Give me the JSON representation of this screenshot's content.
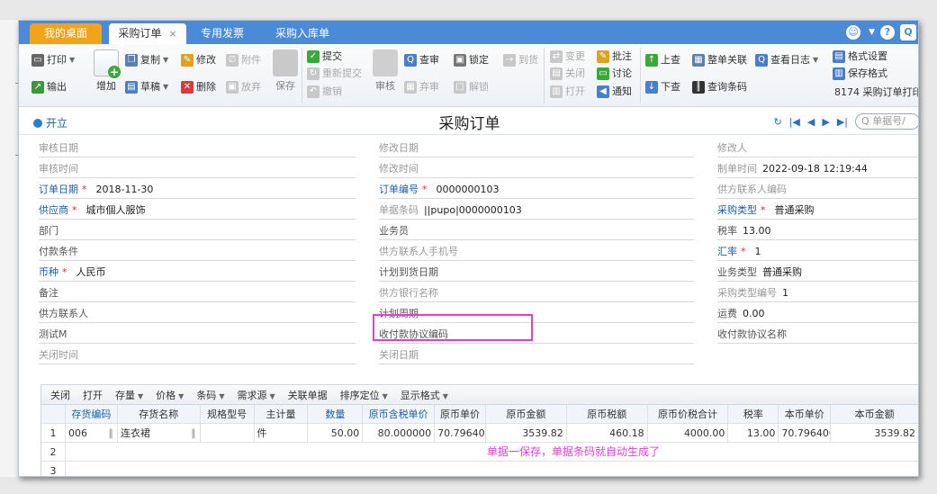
{
  "tabs": [
    {
      "label": "我的桌面"
    },
    {
      "label": "采购订单",
      "close": "×"
    },
    {
      "label": "专用发票"
    },
    {
      "label": "采购入库单"
    }
  ],
  "toolbar": {
    "print": "打印",
    "export": "输出",
    "add": "增加",
    "copy": "复制",
    "draft": "草稿",
    "edit": "修改",
    "delete": "删除",
    "attach": "附件",
    "abandon": "放弃",
    "save": "保存",
    "submit": "提交",
    "resubmit": "重新提交",
    "revoke": "撤销",
    "audit": "审核",
    "query_audit": "查审",
    "discard": "弃审",
    "lock": "锁定",
    "unlock": "解锁",
    "to_goods": "到货",
    "change": "变更",
    "close": "关闭",
    "open": "打开",
    "annotate": "批注",
    "discuss": "讨论",
    "notify": "通知",
    "prev": "上查",
    "next": "下查",
    "whole_link": "整单关联",
    "query_barcode": "查询条码",
    "view_log": "查看日志",
    "format_setting": "格式设置",
    "save_format": "保存格式",
    "print_template": "8174 采购订单打印"
  },
  "header": {
    "kaili": "开立",
    "title": "采购订单",
    "search_placeholder": "单据号/"
  },
  "form": {
    "audit_date": {
      "label": "审核日期",
      "value": ""
    },
    "audit_time": {
      "label": "审核时间",
      "value": ""
    },
    "order_date": {
      "label": "订单日期",
      "value": "2018-11-30"
    },
    "supplier": {
      "label": "供应商",
      "value": "城市個人服饰"
    },
    "dept": {
      "label": "部门",
      "value": ""
    },
    "pay_terms": {
      "label": "付款条件",
      "value": ""
    },
    "currency": {
      "label": "币种",
      "value": "人民币"
    },
    "remark": {
      "label": "备注",
      "value": ""
    },
    "supplier_contact": {
      "label": "供方联系人",
      "value": ""
    },
    "test_m": {
      "label": "测试M",
      "value": ""
    },
    "close_time": {
      "label": "关闭时间",
      "value": ""
    },
    "modify_date": {
      "label": "修改日期",
      "value": ""
    },
    "modify_time": {
      "label": "修改时间",
      "value": ""
    },
    "order_no": {
      "label": "订单编号",
      "value": "0000000103"
    },
    "barcode": {
      "label": "单据条码",
      "value": "||pupo|0000000103"
    },
    "salesman": {
      "label": "业务员",
      "value": ""
    },
    "contact_phone": {
      "label": "供方联系人手机号",
      "value": ""
    },
    "plan_arrival": {
      "label": "计划到货日期",
      "value": ""
    },
    "supplier_bank": {
      "label": "供方银行名称",
      "value": ""
    },
    "plan_period": {
      "label": "计划周期",
      "value": ""
    },
    "agreement_code": {
      "label": "收付款协议编码",
      "value": ""
    },
    "close_date": {
      "label": "关闭日期",
      "value": ""
    },
    "modifier": {
      "label": "修改人",
      "value": ""
    },
    "creator_time": {
      "label": "制单时间",
      "value": "2022-09-18 12:19:44"
    },
    "supplier_contact_code": {
      "label": "供方联系人编码",
      "value": ""
    },
    "purchase_type": {
      "label": "采购类型",
      "value": "普通采购"
    },
    "tax_rate": {
      "label": "税率",
      "value": "13.00"
    },
    "exchange_rate": {
      "label": "汇率",
      "value": "1"
    },
    "business_type": {
      "label": "业务类型",
      "value": "普通采购"
    },
    "purchase_type_code": {
      "label": "采购类型编号",
      "value": "1"
    },
    "freight": {
      "label": "运费",
      "value": "0.00"
    },
    "agreement_name": {
      "label": "收付款协议名称",
      "value": ""
    }
  },
  "grid": {
    "toolbar": [
      "关闭",
      "打开",
      "存量",
      "价格",
      "条码",
      "需求源",
      "关联单据",
      "排序定位",
      "显示格式"
    ],
    "columns": [
      "",
      "存货编码",
      "存货名称",
      "规格型号",
      "主计量",
      "数量",
      "原币含税单价",
      "原币单价",
      "原币金额",
      "原币税额",
      "原币价税合计",
      "税率",
      "本币单价",
      "本币金额"
    ],
    "rows": [
      {
        "no": "1",
        "code": "006",
        "name": "连衣裙",
        "spec": "",
        "unit": "件",
        "qty": "50.00",
        "tax_price": "80.000000",
        "price": "70.796400",
        "amount": "3539.82",
        "tax": "460.18",
        "total": "4000.00",
        "rate": "13.00",
        "local_price": "70.796400",
        "local_amount": "3539.82"
      },
      {
        "no": "2"
      },
      {
        "no": "3"
      }
    ]
  },
  "annotation": "单据一保存，单据条码就自动生成了",
  "colors": {
    "accent": "#4a8ad6",
    "home_tab": "#f3a318",
    "highlight": "#e13ed8",
    "required": "#e0263b"
  }
}
